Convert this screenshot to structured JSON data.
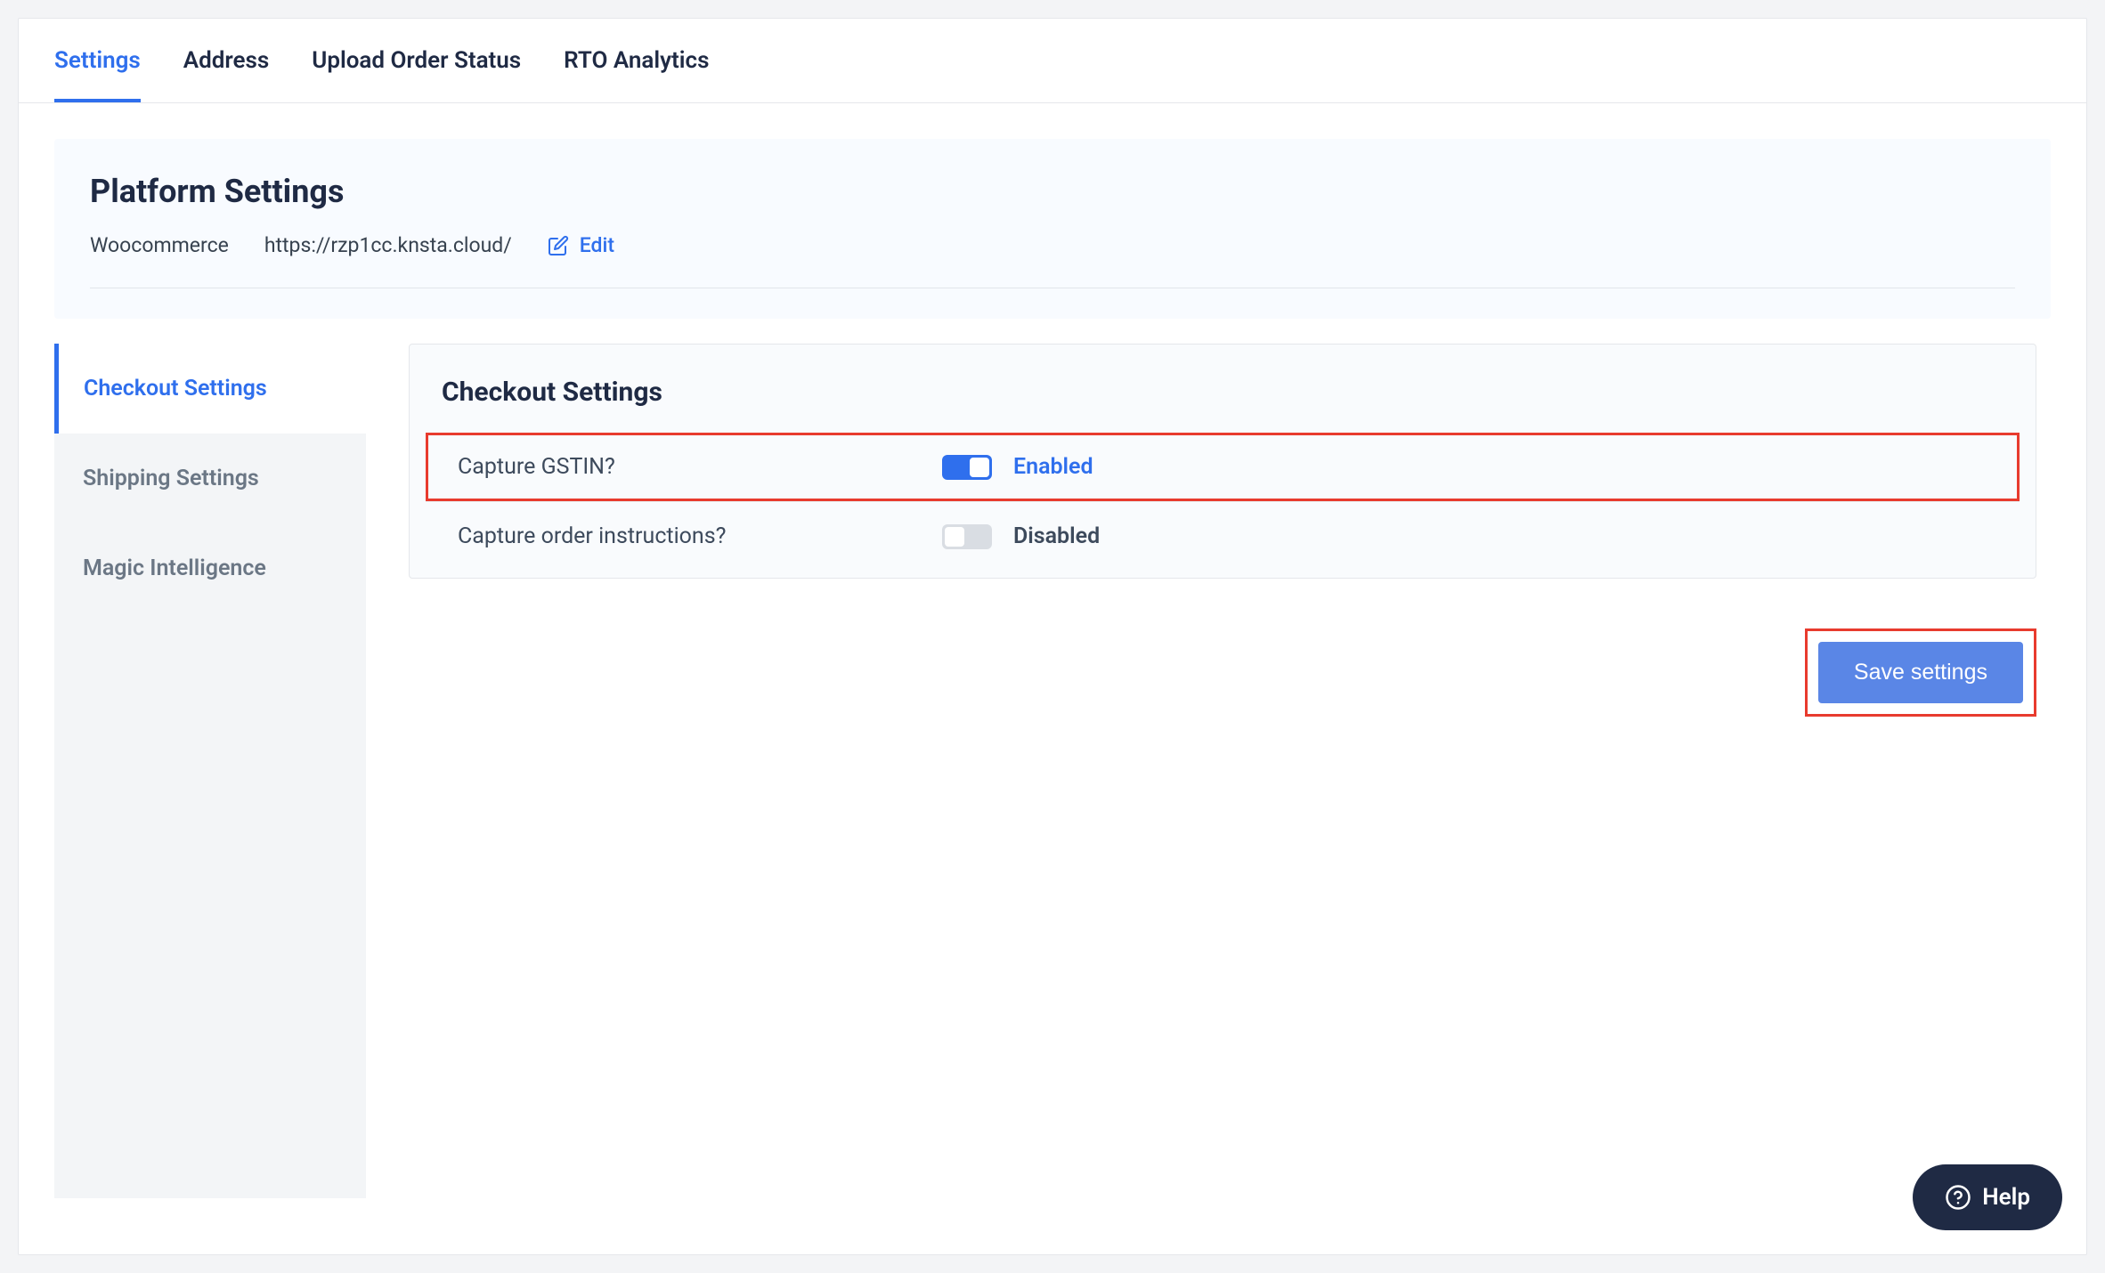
{
  "tabs": {
    "items": [
      {
        "label": "Settings",
        "active": true
      },
      {
        "label": "Address",
        "active": false
      },
      {
        "label": "Upload Order Status",
        "active": false
      },
      {
        "label": "RTO Analytics",
        "active": false
      }
    ]
  },
  "platform": {
    "title": "Platform Settings",
    "name": "Woocommerce",
    "url": "https://rzp1cc.knsta.cloud/",
    "edit_label": "Edit"
  },
  "side_nav": {
    "items": [
      {
        "label": "Checkout Settings",
        "active": true
      },
      {
        "label": "Shipping Settings",
        "active": false
      },
      {
        "label": "Magic Intelligence",
        "active": false
      }
    ]
  },
  "checkout": {
    "title": "Checkout Settings",
    "rows": [
      {
        "label": "Capture GSTIN?",
        "enabled": true,
        "state_label": "Enabled",
        "highlight": true
      },
      {
        "label": "Capture order instructions?",
        "enabled": false,
        "state_label": "Disabled",
        "highlight": false
      }
    ]
  },
  "actions": {
    "save_label": "Save settings",
    "save_highlight": true
  },
  "help": {
    "label": "Help"
  },
  "colors": {
    "primary": "#2f6fed",
    "text_dark": "#1f2a44",
    "highlight_red": "#e83b2e"
  }
}
